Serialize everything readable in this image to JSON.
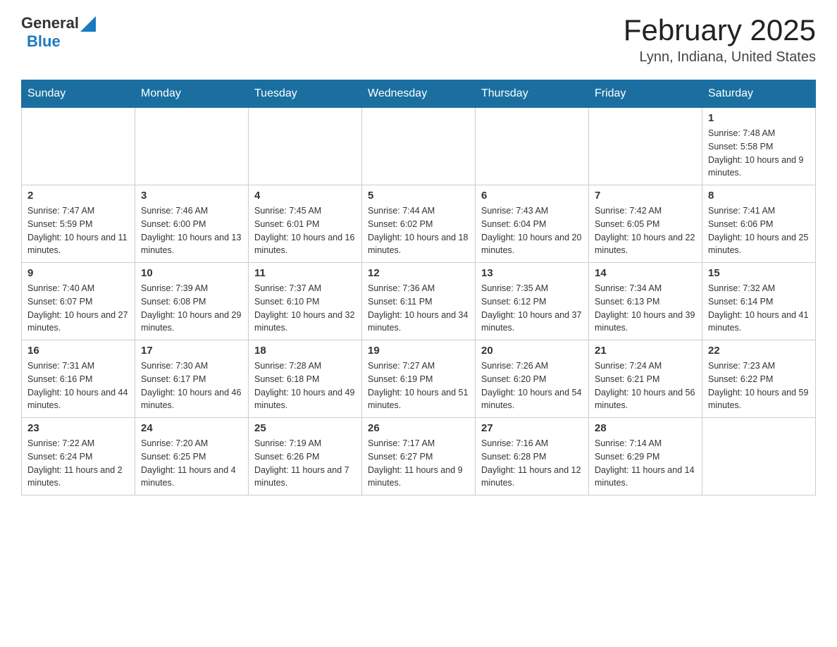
{
  "header": {
    "logo_general": "General",
    "logo_blue": "Blue",
    "month_title": "February 2025",
    "location": "Lynn, Indiana, United States"
  },
  "days_of_week": [
    "Sunday",
    "Monday",
    "Tuesday",
    "Wednesday",
    "Thursday",
    "Friday",
    "Saturday"
  ],
  "weeks": [
    [
      {
        "day": "",
        "info": ""
      },
      {
        "day": "",
        "info": ""
      },
      {
        "day": "",
        "info": ""
      },
      {
        "day": "",
        "info": ""
      },
      {
        "day": "",
        "info": ""
      },
      {
        "day": "",
        "info": ""
      },
      {
        "day": "1",
        "info": "Sunrise: 7:48 AM\nSunset: 5:58 PM\nDaylight: 10 hours and 9 minutes."
      }
    ],
    [
      {
        "day": "2",
        "info": "Sunrise: 7:47 AM\nSunset: 5:59 PM\nDaylight: 10 hours and 11 minutes."
      },
      {
        "day": "3",
        "info": "Sunrise: 7:46 AM\nSunset: 6:00 PM\nDaylight: 10 hours and 13 minutes."
      },
      {
        "day": "4",
        "info": "Sunrise: 7:45 AM\nSunset: 6:01 PM\nDaylight: 10 hours and 16 minutes."
      },
      {
        "day": "5",
        "info": "Sunrise: 7:44 AM\nSunset: 6:02 PM\nDaylight: 10 hours and 18 minutes."
      },
      {
        "day": "6",
        "info": "Sunrise: 7:43 AM\nSunset: 6:04 PM\nDaylight: 10 hours and 20 minutes."
      },
      {
        "day": "7",
        "info": "Sunrise: 7:42 AM\nSunset: 6:05 PM\nDaylight: 10 hours and 22 minutes."
      },
      {
        "day": "8",
        "info": "Sunrise: 7:41 AM\nSunset: 6:06 PM\nDaylight: 10 hours and 25 minutes."
      }
    ],
    [
      {
        "day": "9",
        "info": "Sunrise: 7:40 AM\nSunset: 6:07 PM\nDaylight: 10 hours and 27 minutes."
      },
      {
        "day": "10",
        "info": "Sunrise: 7:39 AM\nSunset: 6:08 PM\nDaylight: 10 hours and 29 minutes."
      },
      {
        "day": "11",
        "info": "Sunrise: 7:37 AM\nSunset: 6:10 PM\nDaylight: 10 hours and 32 minutes."
      },
      {
        "day": "12",
        "info": "Sunrise: 7:36 AM\nSunset: 6:11 PM\nDaylight: 10 hours and 34 minutes."
      },
      {
        "day": "13",
        "info": "Sunrise: 7:35 AM\nSunset: 6:12 PM\nDaylight: 10 hours and 37 minutes."
      },
      {
        "day": "14",
        "info": "Sunrise: 7:34 AM\nSunset: 6:13 PM\nDaylight: 10 hours and 39 minutes."
      },
      {
        "day": "15",
        "info": "Sunrise: 7:32 AM\nSunset: 6:14 PM\nDaylight: 10 hours and 41 minutes."
      }
    ],
    [
      {
        "day": "16",
        "info": "Sunrise: 7:31 AM\nSunset: 6:16 PM\nDaylight: 10 hours and 44 minutes."
      },
      {
        "day": "17",
        "info": "Sunrise: 7:30 AM\nSunset: 6:17 PM\nDaylight: 10 hours and 46 minutes."
      },
      {
        "day": "18",
        "info": "Sunrise: 7:28 AM\nSunset: 6:18 PM\nDaylight: 10 hours and 49 minutes."
      },
      {
        "day": "19",
        "info": "Sunrise: 7:27 AM\nSunset: 6:19 PM\nDaylight: 10 hours and 51 minutes."
      },
      {
        "day": "20",
        "info": "Sunrise: 7:26 AM\nSunset: 6:20 PM\nDaylight: 10 hours and 54 minutes."
      },
      {
        "day": "21",
        "info": "Sunrise: 7:24 AM\nSunset: 6:21 PM\nDaylight: 10 hours and 56 minutes."
      },
      {
        "day": "22",
        "info": "Sunrise: 7:23 AM\nSunset: 6:22 PM\nDaylight: 10 hours and 59 minutes."
      }
    ],
    [
      {
        "day": "23",
        "info": "Sunrise: 7:22 AM\nSunset: 6:24 PM\nDaylight: 11 hours and 2 minutes."
      },
      {
        "day": "24",
        "info": "Sunrise: 7:20 AM\nSunset: 6:25 PM\nDaylight: 11 hours and 4 minutes."
      },
      {
        "day": "25",
        "info": "Sunrise: 7:19 AM\nSunset: 6:26 PM\nDaylight: 11 hours and 7 minutes."
      },
      {
        "day": "26",
        "info": "Sunrise: 7:17 AM\nSunset: 6:27 PM\nDaylight: 11 hours and 9 minutes."
      },
      {
        "day": "27",
        "info": "Sunrise: 7:16 AM\nSunset: 6:28 PM\nDaylight: 11 hours and 12 minutes."
      },
      {
        "day": "28",
        "info": "Sunrise: 7:14 AM\nSunset: 6:29 PM\nDaylight: 11 hours and 14 minutes."
      },
      {
        "day": "",
        "info": ""
      }
    ]
  ]
}
